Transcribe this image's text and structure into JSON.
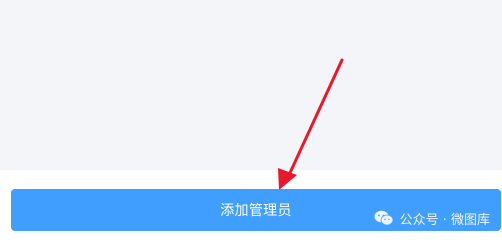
{
  "colors": {
    "background": "#f4f5f9",
    "bottom_bar": "#ffffff",
    "button": "#409eff",
    "button_text": "#ffffff",
    "arrow": "#e8192c"
  },
  "button": {
    "label": "添加管理员"
  },
  "watermark": {
    "icon": "wechat-icon",
    "text": "公众号 · 微图库"
  }
}
